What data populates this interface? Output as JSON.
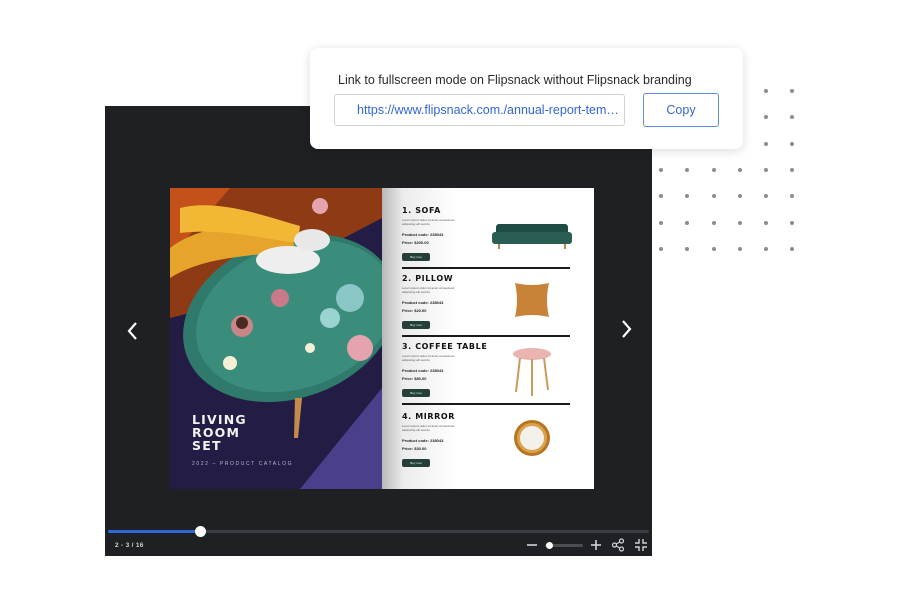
{
  "popup": {
    "label": "Link to fullscreen mode on Flipsnack without Flipsnack branding",
    "url_value": "https://www.flipsnack.com./annual-report-templat...",
    "copy_label": "Copy"
  },
  "viewer": {
    "cover": {
      "title": "LIVING\nROOM\nSET",
      "subtitle": "2022 – PRODUCT CATALOG"
    },
    "products": [
      {
        "name": "1. SOFA",
        "desc": "Lorem ipsum dolor sit amet consectetur adipiscing elit sed do",
        "code": "Product code: 238043",
        "price": "Price: $200.00",
        "button": "Buy now",
        "icon": "sofa-image"
      },
      {
        "name": "2. PILLOW",
        "desc": "Lorem ipsum dolor sit amet consectetur adipiscing elit sed do",
        "code": "Product code: 238043",
        "price": "Price: $20.00",
        "button": "Buy now",
        "icon": "pillow-image"
      },
      {
        "name": "3. COFFEE TABLE",
        "desc": "Lorem ipsum dolor sit amet consectetur adipiscing elit sed do",
        "code": "Product code: 238043",
        "price": "Price: $80.00",
        "button": "Buy now",
        "icon": "coffee-table-image"
      },
      {
        "name": "4. MIRROR",
        "desc": "Lorem ipsum dolor sit amet consectetur adipiscing elit sed do",
        "code": "Product code: 238043",
        "price": "Price: $30.00",
        "button": "Buy now",
        "icon": "mirror-image"
      }
    ],
    "page_indicator": "2 - 3 / 16",
    "progress": 0.17,
    "zoom_level": 0.1,
    "colors": {
      "viewer_bg": "#1e2023",
      "progress_fill": "#2f67d6",
      "accent_link": "#3367d6",
      "buy_button": "#25403a"
    },
    "icons": {
      "prev": "chevron-left-icon",
      "next": "chevron-right-icon",
      "zoom_out": "minus-icon",
      "zoom_in": "plus-icon",
      "share": "share-icon",
      "exit_fullscreen": "exit-fullscreen-icon"
    }
  }
}
